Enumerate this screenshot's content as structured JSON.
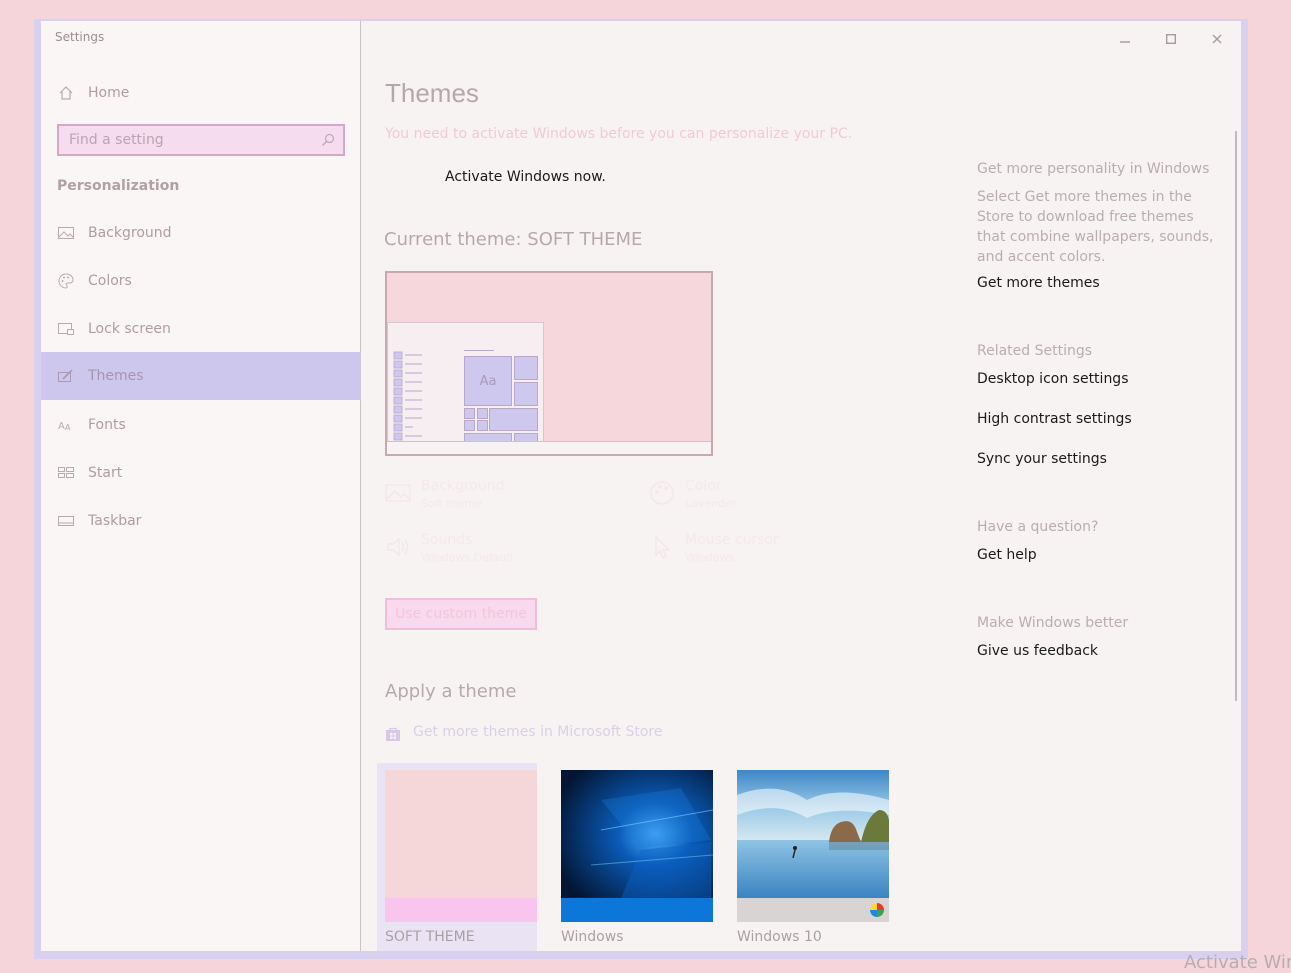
{
  "window": {
    "title": "Settings"
  },
  "sidebar": {
    "home_label": "Home",
    "search_placeholder": "Find a setting",
    "section": "Personalization",
    "items": [
      {
        "label": "Background",
        "icon": "picture-icon"
      },
      {
        "label": "Colors",
        "icon": "palette-icon"
      },
      {
        "label": "Lock screen",
        "icon": "lock-screen-icon"
      },
      {
        "label": "Themes",
        "icon": "brush-icon",
        "selected": true
      },
      {
        "label": "Fonts",
        "icon": "font-icon"
      },
      {
        "label": "Start",
        "icon": "start-icon"
      },
      {
        "label": "Taskbar",
        "icon": "taskbar-icon"
      }
    ]
  },
  "main": {
    "title": "Themes",
    "activation_warning": "You need to activate Windows before you can personalize your PC.",
    "activate_link": "Activate Windows now.",
    "current_theme": "Current theme: SOFT THEME",
    "preview_tile_text": "Aa",
    "options": [
      {
        "title": "Background",
        "subtitle": "Soft theme",
        "icon": "picture-icon"
      },
      {
        "title": "Color",
        "subtitle": "Lavender",
        "icon": "palette-icon"
      },
      {
        "title": "Sounds",
        "subtitle": "Windows Default",
        "icon": "speaker-icon"
      },
      {
        "title": "Mouse cursor",
        "subtitle": "Windows",
        "icon": "cursor-icon"
      }
    ],
    "custom_theme_button": "Use custom theme",
    "apply_heading": "Apply a theme",
    "store_link": "Get more themes in Microsoft Store",
    "themes": [
      {
        "name": "SOFT THEME",
        "selected": true
      },
      {
        "name": "Windows"
      },
      {
        "name": "Windows 10"
      }
    ]
  },
  "right": {
    "personality_heading": "Get more personality in Windows",
    "personality_text": "Select Get more themes in the Store to download free themes that combine wallpapers, sounds, and accent colors.",
    "get_more_themes": "Get more themes",
    "related_heading": "Related Settings",
    "related_links": [
      "Desktop icon settings",
      "High contrast settings",
      "Sync your settings"
    ],
    "question_heading": "Have a question?",
    "get_help": "Get help",
    "better_heading": "Make Windows better",
    "feedback": "Give us feedback"
  },
  "watermark": "Activate Wir",
  "colors": {
    "accent": "#cdc7ee",
    "background_pink": "#f5d5d9"
  }
}
